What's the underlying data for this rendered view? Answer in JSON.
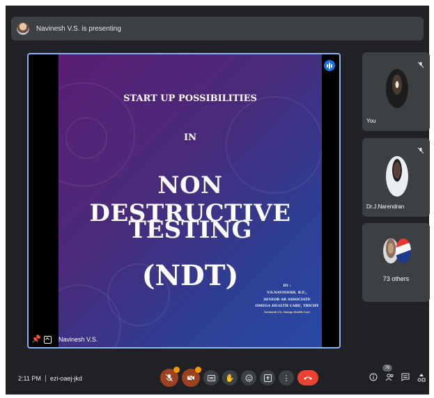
{
  "presenting_bar": {
    "text": "Navinesh V.S. is presenting"
  },
  "slide": {
    "subtitle": "START UP POSSIBILITIES",
    "connector": "IN",
    "title_line1": "NON DESTRUCTIVE",
    "title_line2": "TESTING",
    "title_line3": "(NDT)",
    "credits": {
      "by": "BY :",
      "author": "V.S.NAVINESH, B.E.,",
      "role": "SENIOR AR ASSOCIATE",
      "org": "OMEGA HEALTH CARE, TRICHY",
      "tiny": "Navinesh V.S. Omega Health Care"
    }
  },
  "stage": {
    "presenter_name": "Navinesh V.S."
  },
  "tiles": {
    "you": {
      "name": "You"
    },
    "doctor": {
      "name": "Dr.J.Narendran"
    },
    "others": {
      "name": "73 others"
    }
  },
  "bottom": {
    "time": "2:11 PM",
    "meeting_code": "ezi-oaej-jkd",
    "people_count": "76"
  },
  "icons": {
    "mic": "mic-off-icon",
    "camera": "camera-off-icon",
    "captions": "captions-icon",
    "hand": "raise-hand-icon",
    "emoji": "emoji-icon",
    "present": "present-icon",
    "more": "more-options-icon",
    "end": "end-call-icon"
  },
  "colors": {
    "accent": "#8ab4f8",
    "end_call": "#ea4335",
    "muted_ctl": "#9c4221",
    "badge": "#f29900"
  }
}
